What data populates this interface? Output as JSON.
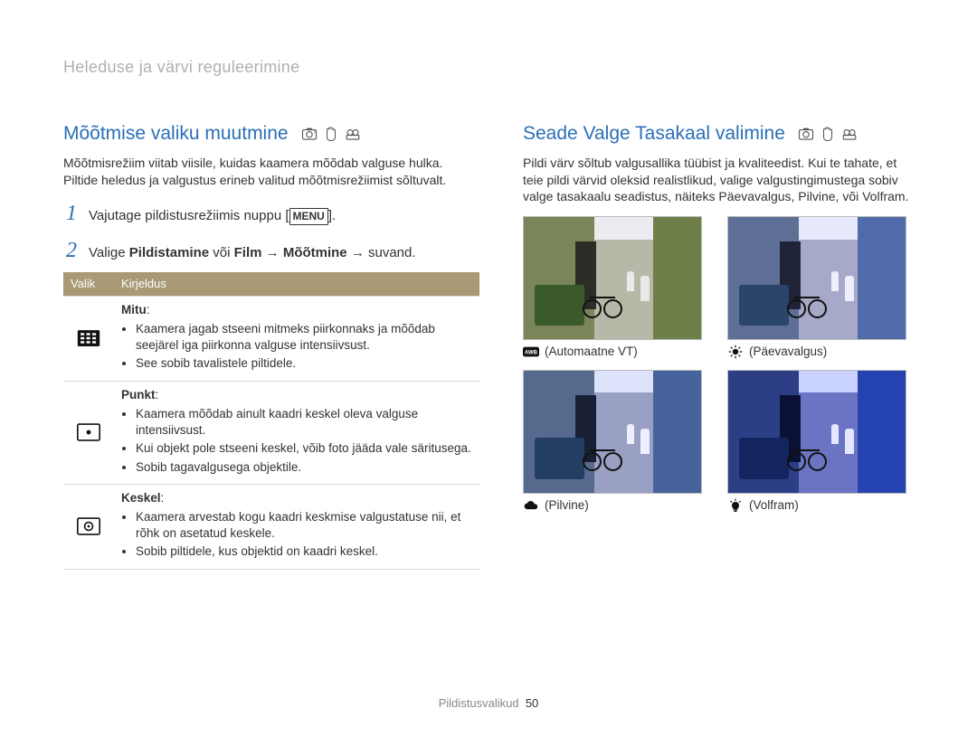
{
  "breadcrumb": "Heleduse ja värvi reguleerimine",
  "left": {
    "title": "Mõõtmise valiku muutmine",
    "lead": "Mõõtmisrežiim viitab viisile, kuidas kaamera mõõdab valguse hulka. Piltide heledus ja valgustus erineb valitud mõõtmisrežiimist sõltuvalt.",
    "step1_pre": "Vajutage pildistusrežiimis nuppu [",
    "step1_badge": "MENU",
    "step1_post": "].",
    "step2_pre": "Valige ",
    "step2_b1": "Pildistamine",
    "step2_mid1": " või ",
    "step2_b2": "Film",
    "step2_mid2": " → ",
    "step2_b3": "Mõõtmine",
    "step2_post": " → suvand.",
    "th_icon": "Valik",
    "th_desc": "Kirjeldus",
    "options": {
      "mitu": {
        "name": "Mitu",
        "b1": "Kaamera jagab stseeni mitmeks piirkonnaks ja mõõdab seejärel iga piirkonna valguse intensiivsust.",
        "b2": "See sobib tavalistele piltidele."
      },
      "punkt": {
        "name": "Punkt",
        "b1": "Kaamera mõõdab ainult kaadri keskel oleva valguse intensiivsust.",
        "b2": "Kui objekt pole stseeni keskel, võib foto jääda vale säritusega.",
        "b3": "Sobib tagavalgusega objektile."
      },
      "keskel": {
        "name": "Keskel",
        "b1": "Kaamera arvestab kogu kaadri keskmise valgustatuse nii, et rõhk on asetatud keskele.",
        "b2": "Sobib piltidele, kus objektid on kaadri keskel."
      }
    }
  },
  "right": {
    "title": "Seade Valge Tasakaal valimine",
    "lead": "Pildi värv sõltub valgusallika tüübist ja kvaliteedist. Kui te tahate, et teie pildi värvid oleksid realistlikud, valige valgustingimustega sobiv valge tasakaalu seadistus, näiteks Päevavalgus, Pilvine, või Volfram.",
    "wb": {
      "auto": "(Automaatne VT)",
      "daylight": "(Päevavalgus)",
      "cloudy": "(Pilvine)",
      "tungsten": "(Volfram)"
    }
  },
  "footer": {
    "section": "Pildistusvalikud",
    "page": "50"
  }
}
